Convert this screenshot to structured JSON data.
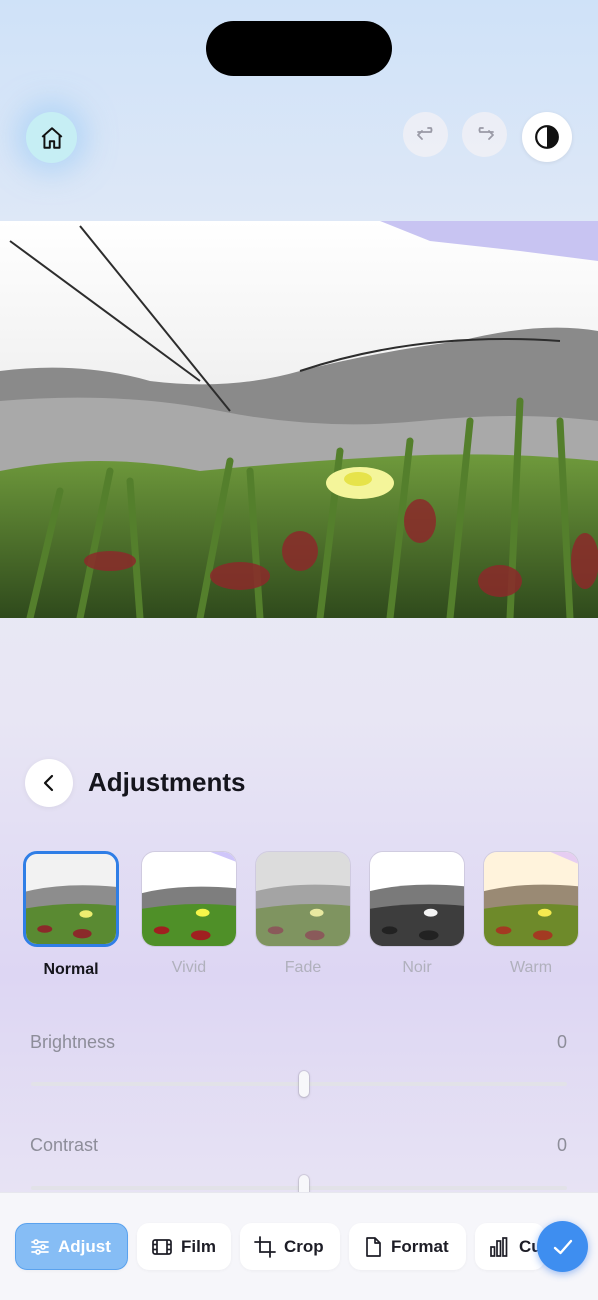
{
  "header": {
    "home_icon": "home-icon",
    "undo_icon": "undo-icon",
    "redo_icon": "redo-icon",
    "compare_icon": "contrast-icon"
  },
  "panel": {
    "title": "Adjustments",
    "back_icon": "chevron-left-icon"
  },
  "filters": [
    {
      "label": "Normal",
      "selected": true
    },
    {
      "label": "Vivid",
      "selected": false
    },
    {
      "label": "Fade",
      "selected": false
    },
    {
      "label": "Noir",
      "selected": false
    },
    {
      "label": "Warm",
      "selected": false
    }
  ],
  "sliders": [
    {
      "label": "Brightness",
      "value": "0",
      "level": 0.51
    },
    {
      "label": "Contrast",
      "value": "0",
      "level": 0.51
    }
  ],
  "tabs": [
    {
      "label": "Adjust",
      "icon": "sliders-icon",
      "active": true
    },
    {
      "label": "Film",
      "icon": "film-icon",
      "active": false
    },
    {
      "label": "Crop",
      "icon": "crop-icon",
      "active": false
    },
    {
      "label": "Format",
      "icon": "document-icon",
      "active": false
    },
    {
      "label": "Cu",
      "icon": "bar-chart-icon",
      "active": false
    }
  ],
  "confirm_icon": "checkmark-icon",
  "colors": {
    "accent": "#3e8ef0",
    "active_tab": "#86bdf5",
    "selected_border": "#2f7ee6"
  }
}
